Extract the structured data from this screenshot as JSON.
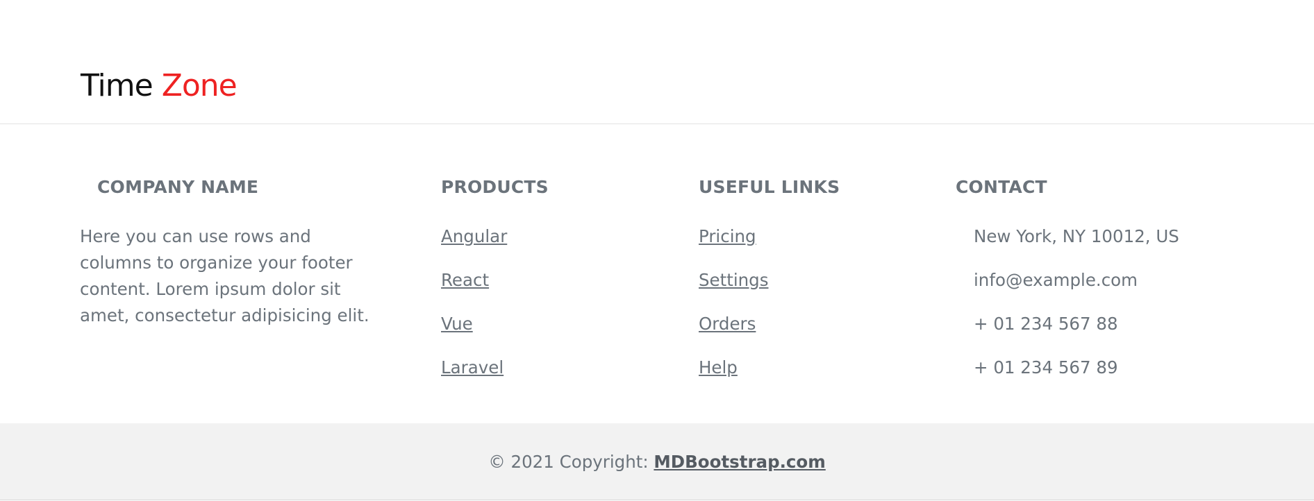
{
  "brand": {
    "part1": "Time",
    "part2": "Zone",
    "accent_color": "#ee2222"
  },
  "company": {
    "heading": "COMPANY NAME",
    "description": "Here you can use rows and columns to organize your footer content. Lorem ipsum dolor sit amet, consectetur adipisicing elit."
  },
  "products": {
    "heading": "PRODUCTS",
    "items": [
      {
        "label": "Angular"
      },
      {
        "label": "React"
      },
      {
        "label": "Vue"
      },
      {
        "label": "Laravel"
      }
    ]
  },
  "useful_links": {
    "heading": "USEFUL LINKS",
    "items": [
      {
        "label": "Pricing"
      },
      {
        "label": "Settings"
      },
      {
        "label": "Orders"
      },
      {
        "label": "Help"
      }
    ]
  },
  "contact": {
    "heading": "CONTACT",
    "items": [
      {
        "text": "New York, NY 10012, US"
      },
      {
        "text": "info@example.com"
      },
      {
        "text": "+ 01 234 567 88"
      },
      {
        "text": "+ 01 234 567 89"
      }
    ]
  },
  "copyright": {
    "prefix": "© 2021 Copyright: ",
    "link": "MDBootstrap.com"
  }
}
